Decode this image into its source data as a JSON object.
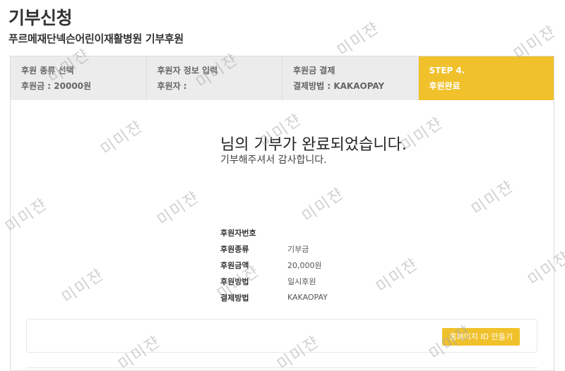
{
  "header": {
    "title": "기부신청",
    "subtitle": "푸르메재단넥슨어린이재활병원 기부후원"
  },
  "steps": [
    {
      "line1": "후원 종류 선택",
      "line2": "후원금 : 20000원"
    },
    {
      "line1": "후원자 정보 입력",
      "line2": "후원자 :"
    },
    {
      "line1": "후원금 결제",
      "line2": "결제방법 : KAKAOPAY"
    },
    {
      "line1": "STEP 4.",
      "line2": "후원완료"
    }
  ],
  "completion": {
    "title": "님의 기부가 완료되었습니다.",
    "subtitle": "기부해주셔서 감사합니다."
  },
  "info": {
    "rows": [
      {
        "label": "후원자번호",
        "value": ""
      },
      {
        "label": "후원종류",
        "value": "기부금"
      },
      {
        "label": "후원금액",
        "value": "20,000원"
      },
      {
        "label": "후원방법",
        "value": "일시후원"
      },
      {
        "label": "결제방법",
        "value": "KAKAOPAY"
      }
    ]
  },
  "actions": {
    "homepage_id_button": "홈페이지 ID 만들기"
  },
  "watermark": "미미쟌",
  "colors": {
    "accent": "#f0c12b",
    "step_bg": "#ececec"
  }
}
